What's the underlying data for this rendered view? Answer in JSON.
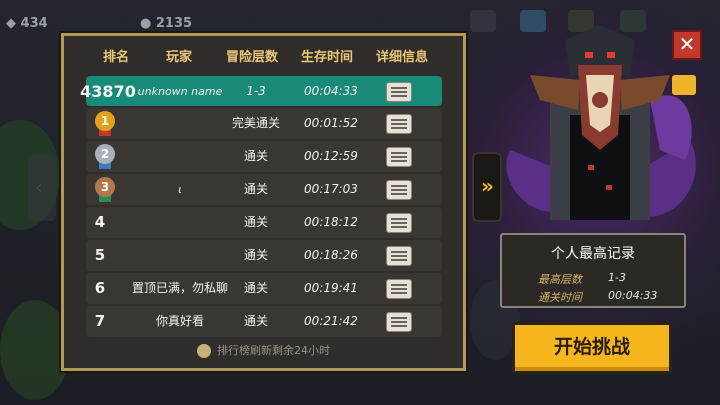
{
  "currency": {
    "gems": "434",
    "coins": "2135"
  },
  "leaderboard": {
    "headers": {
      "rank": "排名",
      "player": "玩家",
      "layer": "冒险层数",
      "time": "生存时间",
      "detail": "详细信息"
    },
    "rows": [
      {
        "rank": "43870",
        "player": "unknown name",
        "layer": "1-3",
        "time": "00:04:33",
        "medal": "none",
        "highlight": true
      },
      {
        "rank": "1",
        "player": "",
        "layer": "完美通关",
        "time": "00:01:52",
        "medal": "gold"
      },
      {
        "rank": "2",
        "player": "",
        "layer": "通关",
        "time": "00:12:59",
        "medal": "silver"
      },
      {
        "rank": "3",
        "player": "ι",
        "layer": "通关",
        "time": "00:17:03",
        "medal": "bronze"
      },
      {
        "rank": "4",
        "player": "",
        "layer": "通关",
        "time": "00:18:12",
        "medal": "none"
      },
      {
        "rank": "5",
        "player": "",
        "layer": "通关",
        "time": "00:18:26",
        "medal": "none"
      },
      {
        "rank": "6",
        "player": "置顶已满，勿私聊",
        "layer": "通关",
        "time": "00:19:41",
        "medal": "none"
      },
      {
        "rank": "7",
        "player": "你真好看",
        "layer": "通关",
        "time": "00:21:42",
        "medal": "none"
      }
    ],
    "footer": "排行榜刷新剩余24小时"
  },
  "record": {
    "title": "个人最高记录",
    "layer_label": "最高层数",
    "layer_value": "1-3",
    "time_label": "通关时间",
    "time_value": "00:04:33"
  },
  "start_label": "开始挑战",
  "close_icon": "close-icon",
  "arrow_icon": "chevron-right-icon",
  "colors": {
    "accent": "#f5b61e",
    "highlight_row": "#1a8a78",
    "panel_border": "#b39a53",
    "header_text": "#e9c777"
  }
}
